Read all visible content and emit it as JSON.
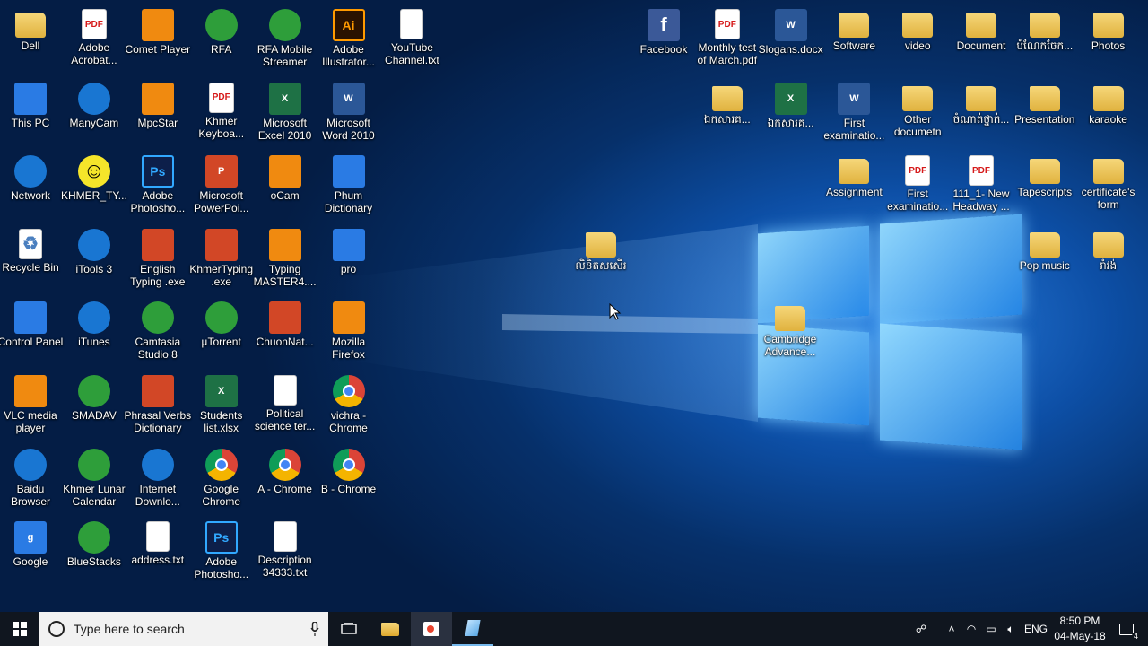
{
  "desktop": {
    "icons_left": [
      {
        "label": "Dell",
        "icon": "folder-icon"
      },
      {
        "label": "Adobe Acrobat...",
        "icon": "pdf-icon"
      },
      {
        "label": "Comet Player",
        "icon": "star-icon"
      },
      {
        "label": "RFA",
        "icon": "rfa-icon"
      },
      {
        "label": "RFA Mobile Streamer",
        "icon": "rfa-icon"
      },
      {
        "label": "Adobe Illustrator...",
        "icon": "illustrator-icon"
      },
      {
        "label": "YouTube Channel.txt",
        "icon": "text-file-icon"
      },
      {
        "label": "This PC",
        "icon": "computer-icon"
      },
      {
        "label": "ManyCam",
        "icon": "webcam-icon"
      },
      {
        "label": "MpcStar",
        "icon": "star-icon"
      },
      {
        "label": "Khmer Keyboa...",
        "icon": "pdf-icon"
      },
      {
        "label": "Microsoft Excel 2010",
        "icon": "excel-icon"
      },
      {
        "label": "Microsoft Word 2010",
        "icon": "word-icon"
      },
      {
        "label": "Network",
        "icon": "network-icon"
      },
      {
        "label": "KHMER_TY...",
        "icon": "smiley-icon"
      },
      {
        "label": "Adobe Photosho...",
        "icon": "photoshop-icon"
      },
      {
        "label": "Microsoft PowerPoi...",
        "icon": "powerpoint-icon"
      },
      {
        "label": "oCam",
        "icon": "ocam-icon"
      },
      {
        "label": "Phum Dictionary",
        "icon": "dictionary-icon"
      },
      {
        "label": "Recycle Bin",
        "icon": "recycle-bin-icon"
      },
      {
        "label": "iTools 3",
        "icon": "itools-icon"
      },
      {
        "label": "English Typing .exe",
        "icon": "typing-icon"
      },
      {
        "label": "KhmerTyping .exe",
        "icon": "typing-icon"
      },
      {
        "label": "Typing MASTER4....",
        "icon": "typing-master-icon"
      },
      {
        "label": "pro",
        "icon": "cald3-icon"
      },
      {
        "label": "Control Panel",
        "icon": "control-panel-icon"
      },
      {
        "label": "iTunes",
        "icon": "itunes-icon"
      },
      {
        "label": "Camtasia Studio 8",
        "icon": "camtasia-icon"
      },
      {
        "label": "µTorrent",
        "icon": "utorrent-icon"
      },
      {
        "label": "ChuonNat...",
        "icon": "book-icon"
      },
      {
        "label": "Mozilla Firefox",
        "icon": "firefox-icon"
      },
      {
        "label": "VLC media player",
        "icon": "vlc-icon"
      },
      {
        "label": "SMADAV",
        "icon": "smadav-icon"
      },
      {
        "label": "Phrasal Verbs Dictionary",
        "icon": "book-icon"
      },
      {
        "label": "Students list.xlsx",
        "icon": "excel-icon"
      },
      {
        "label": "Political science ter...",
        "icon": "document-icon"
      },
      {
        "label": "vichra - Chrome",
        "icon": "chrome-icon"
      },
      {
        "label": "Baidu Browser",
        "icon": "baidu-icon"
      },
      {
        "label": "Khmer Lunar Calendar",
        "icon": "calendar-icon"
      },
      {
        "label": "Internet Downlo...",
        "icon": "idm-icon"
      },
      {
        "label": "Google Chrome",
        "icon": "chrome-icon"
      },
      {
        "label": "A - Chrome",
        "icon": "chrome-icon"
      },
      {
        "label": "B - Chrome",
        "icon": "chrome-icon"
      },
      {
        "label": "Google",
        "icon": "google-icon"
      },
      {
        "label": "BlueStacks",
        "icon": "bluestacks-icon"
      },
      {
        "label": "address.txt",
        "icon": "text-file-icon"
      },
      {
        "label": "Adobe Photosho...",
        "icon": "photoshop-icon"
      },
      {
        "label": "Description 34333.txt",
        "icon": "text-file-icon"
      }
    ],
    "icons_right": [
      {
        "label": "Facebook",
        "icon": "facebook-icon"
      },
      {
        "label": "Monthly test of March.pdf",
        "icon": "pdf-icon"
      },
      {
        "label": "Slogans.docx",
        "icon": "word-icon"
      },
      {
        "label": "Software",
        "icon": "folder-icon"
      },
      {
        "label": "video",
        "icon": "folder-icon"
      },
      {
        "label": "Document",
        "icon": "folder-icon"
      },
      {
        "label": "បំណែកចែក...",
        "icon": "folder-icon"
      },
      {
        "label": "Photos",
        "icon": "folder-icon"
      },
      {
        "label": "ឯកសារគ...",
        "icon": "folder-icon"
      },
      {
        "label": "ឯកសារគ...",
        "icon": "excel-icon"
      },
      {
        "label": "First examinatio...",
        "icon": "word-icon"
      },
      {
        "label": "Other documetn",
        "icon": "folder-icon"
      },
      {
        "label": "ចំណាត់ថ្នាក់...",
        "icon": "folder-icon"
      },
      {
        "label": "Presentation",
        "icon": "folder-icon"
      },
      {
        "label": "karaoke",
        "icon": "folder-icon"
      },
      {
        "label": "Assignment",
        "icon": "folder-icon"
      },
      {
        "label": "First examinatio...",
        "icon": "pdf-icon"
      },
      {
        "label": "111_1- New Headway ...",
        "icon": "pdf-icon"
      },
      {
        "label": "Tapescripts",
        "icon": "folder-icon"
      },
      {
        "label": "certificate's form",
        "icon": "folder-icon"
      },
      {
        "label": "Pop music",
        "icon": "folder-icon"
      },
      {
        "label": "រាំវង់",
        "icon": "folder-icon"
      }
    ],
    "icons_loose": [
      {
        "label": "លិខិតសសើរ",
        "icon": "folder-icon"
      },
      {
        "label": "Cambridge Advance...",
        "icon": "folder-icon"
      }
    ]
  },
  "taskbar": {
    "search_placeholder": "Type here to search",
    "pinned": [
      {
        "name": "task-view",
        "icon": "task-view-icon"
      },
      {
        "name": "file-explorer",
        "icon": "folder-icon"
      },
      {
        "name": "app-1",
        "icon": "ocam-icon"
      },
      {
        "name": "app-2",
        "icon": "notepad-icon"
      }
    ],
    "language": "ENG",
    "time": "8:50 PM",
    "date": "04-May-18",
    "notification_count": "4"
  }
}
